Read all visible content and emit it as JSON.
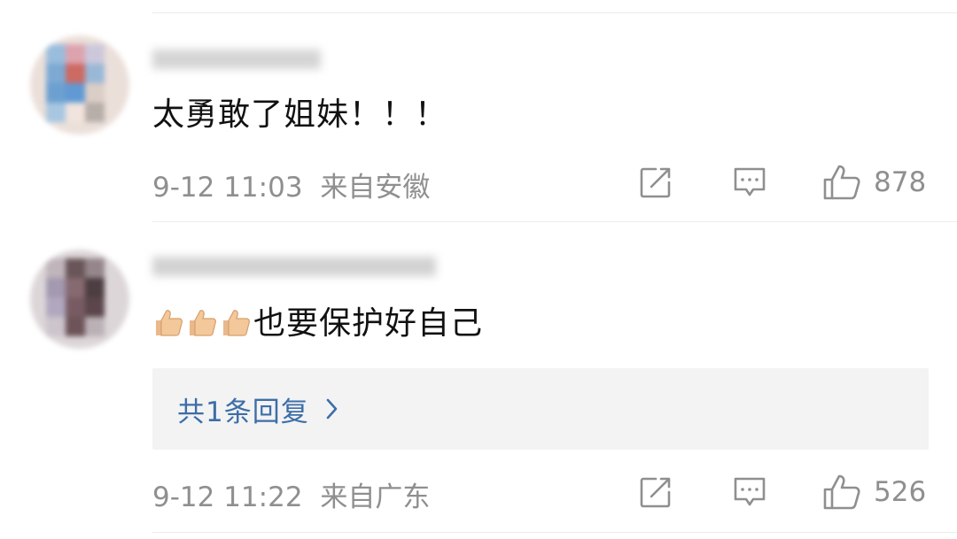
{
  "comments": [
    {
      "text": "太勇敢了姐妹！！！",
      "time": "9-12 11:03",
      "location": "来自安徽",
      "likes": "878"
    },
    {
      "text": "也要保护好自己",
      "emoji_prefix": [
        "thumbs-up",
        "thumbs-up",
        "thumbs-up"
      ],
      "replies_label": "共1条回复",
      "time": "9-12 11:22",
      "location": "来自广东",
      "likes": "526"
    }
  ],
  "colors": {
    "meta_text": "#8f8f8f",
    "reply_link": "#3d6ea8",
    "reply_box_bg": "#f3f3f3"
  }
}
